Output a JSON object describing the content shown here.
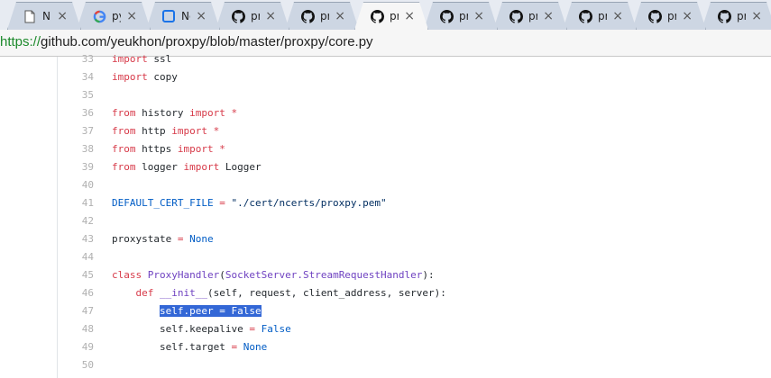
{
  "tabs": [
    {
      "title": "NE",
      "icon": "document-icon",
      "active": false
    },
    {
      "title": "pyt",
      "icon": "google-icon",
      "active": false
    },
    {
      "title": "Ne",
      "icon": "blue-square-icon",
      "active": false
    },
    {
      "title": "pro",
      "icon": "github-icon",
      "active": false
    },
    {
      "title": "pro",
      "icon": "github-icon",
      "active": false
    },
    {
      "title": "pro",
      "icon": "github-icon",
      "active": true
    },
    {
      "title": "pro",
      "icon": "github-icon",
      "active": false
    },
    {
      "title": "pro",
      "icon": "github-icon",
      "active": false
    },
    {
      "title": "pro",
      "icon": "github-icon",
      "active": false
    },
    {
      "title": "pro",
      "icon": "github-icon",
      "active": false
    },
    {
      "title": "pro",
      "icon": "github-icon",
      "active": false
    }
  ],
  "tab_close_glyph": "×",
  "address": {
    "scheme": "https://",
    "rest": "github.com/yeukhon/proxpy/blob/master/proxpy/core.py"
  },
  "code": {
    "lines": [
      {
        "num": "33",
        "tokens": [
          {
            "t": "import",
            "c": "kw"
          },
          {
            "t": " ssl",
            "c": ""
          }
        ]
      },
      {
        "num": "34",
        "tokens": [
          {
            "t": "import",
            "c": "kw"
          },
          {
            "t": " copy",
            "c": ""
          }
        ]
      },
      {
        "num": "35",
        "tokens": []
      },
      {
        "num": "36",
        "tokens": [
          {
            "t": "from",
            "c": "kw"
          },
          {
            "t": " history ",
            "c": ""
          },
          {
            "t": "import",
            "c": "kw"
          },
          {
            "t": " *",
            "c": "kw"
          }
        ]
      },
      {
        "num": "37",
        "tokens": [
          {
            "t": "from",
            "c": "kw"
          },
          {
            "t": " http ",
            "c": ""
          },
          {
            "t": "import",
            "c": "kw"
          },
          {
            "t": " *",
            "c": "kw"
          }
        ]
      },
      {
        "num": "38",
        "tokens": [
          {
            "t": "from",
            "c": "kw"
          },
          {
            "t": " https ",
            "c": ""
          },
          {
            "t": "import",
            "c": "kw"
          },
          {
            "t": " *",
            "c": "kw"
          }
        ]
      },
      {
        "num": "39",
        "tokens": [
          {
            "t": "from",
            "c": "kw"
          },
          {
            "t": " logger ",
            "c": ""
          },
          {
            "t": "import",
            "c": "kw"
          },
          {
            "t": " Logger",
            "c": ""
          }
        ]
      },
      {
        "num": "40",
        "tokens": []
      },
      {
        "num": "41",
        "tokens": [
          {
            "t": "DEFAULT_CERT_FILE",
            "c": "cn"
          },
          {
            "t": " ",
            "c": ""
          },
          {
            "t": "=",
            "c": "kw"
          },
          {
            "t": " ",
            "c": ""
          },
          {
            "t": "\"./cert/ncerts/proxpy.pem\"",
            "c": "st"
          }
        ]
      },
      {
        "num": "42",
        "tokens": []
      },
      {
        "num": "43",
        "tokens": [
          {
            "t": "proxystate ",
            "c": ""
          },
          {
            "t": "=",
            "c": "kw"
          },
          {
            "t": " ",
            "c": ""
          },
          {
            "t": "None",
            "c": "cn"
          }
        ]
      },
      {
        "num": "44",
        "tokens": []
      },
      {
        "num": "45",
        "tokens": [
          {
            "t": "class",
            "c": "kw"
          },
          {
            "t": " ",
            "c": ""
          },
          {
            "t": "ProxyHandler",
            "c": "fn"
          },
          {
            "t": "(",
            "c": ""
          },
          {
            "t": "SocketServer.StreamRequestHandler",
            "c": "fn"
          },
          {
            "t": "):",
            "c": ""
          }
        ]
      },
      {
        "num": "46",
        "tokens": [
          {
            "t": "    ",
            "c": ""
          },
          {
            "t": "def",
            "c": "kw"
          },
          {
            "t": " ",
            "c": ""
          },
          {
            "t": "__init__",
            "c": "fn"
          },
          {
            "t": "(self, request, client_address, server):",
            "c": ""
          }
        ]
      },
      {
        "num": "47",
        "tokens": [
          {
            "t": "        ",
            "c": ""
          },
          {
            "t": "self.peer = False",
            "c": "sel"
          }
        ]
      },
      {
        "num": "48",
        "tokens": [
          {
            "t": "        self.keepalive ",
            "c": ""
          },
          {
            "t": "=",
            "c": "kw"
          },
          {
            "t": " ",
            "c": ""
          },
          {
            "t": "False",
            "c": "cn"
          }
        ]
      },
      {
        "num": "49",
        "tokens": [
          {
            "t": "        self.target ",
            "c": ""
          },
          {
            "t": "=",
            "c": "kw"
          },
          {
            "t": " ",
            "c": ""
          },
          {
            "t": "None",
            "c": "cn"
          }
        ]
      },
      {
        "num": "50",
        "tokens": []
      }
    ]
  }
}
